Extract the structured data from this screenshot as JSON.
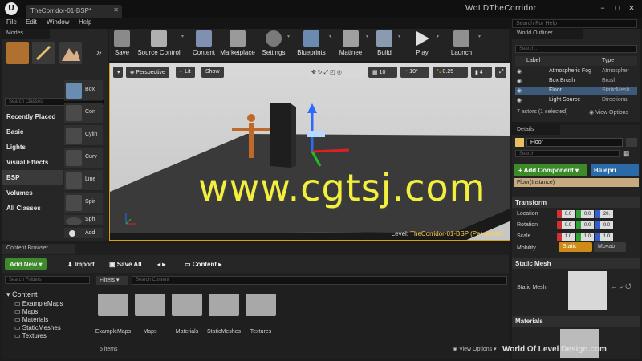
{
  "window": {
    "tab": "TheCorridor-01-BSP*",
    "project": "WoLDTheCorridor",
    "buttons": [
      "−",
      "□",
      "✕"
    ]
  },
  "menu": {
    "items": [
      "File",
      "Edit",
      "Window",
      "Help"
    ],
    "search_placeholder": "Search For Help"
  },
  "modes": {
    "tab": "Modes",
    "search_placeholder": "Search Classes",
    "categories": [
      "Recently Placed",
      "Basic",
      "Lights",
      "Visual Effects",
      "BSP",
      "Volumes",
      "All Classes"
    ],
    "selected_category": "BSP",
    "items": [
      "Box",
      "Con",
      "Cylin",
      "Curv",
      "Line",
      "Spir",
      "Sph",
      "Add"
    ]
  },
  "toolbar": {
    "buttons": [
      "Save",
      "Source Control",
      "Content",
      "Marketplace",
      "Settings",
      "Blueprints",
      "Matinee",
      "Build",
      "Play",
      "Launch"
    ]
  },
  "viewport": {
    "menu": "▾",
    "perspective": "Perspective",
    "lit": "Lit",
    "show": "Show",
    "grid_snap": "10",
    "rot_snap": "10°",
    "scale_snap": "0.25",
    "cam_speed": "4",
    "level_prefix": "Level:",
    "level_name": "TheCorridor-01-BSP (Persistent)",
    "overlay": "www.cgtsj.com"
  },
  "outliner": {
    "tab": "World Outliner",
    "search_placeholder": "Search...",
    "col_label": "Label",
    "col_type": "Type",
    "rows": [
      {
        "name": "Atmospheric Fog",
        "type": "Atmospher"
      },
      {
        "name": "Box Brush",
        "type": "Brush"
      },
      {
        "name": "Floor",
        "type": "StaticMesh"
      },
      {
        "name": "Light Source",
        "type": "Directional"
      }
    ],
    "selected": "Floor",
    "status": "7 actors (1 selected)",
    "view_options": "View Options"
  },
  "details": {
    "tab": "Details",
    "selected_name": "Floor",
    "search_placeholder": "Search",
    "add_component": "+ Add Component ▾",
    "blueprint": "Bluepri",
    "instance": "Floor(Instance)",
    "transform": "Transform",
    "location": "Location",
    "rotation": "Rotation",
    "scale": "Scale",
    "loc": [
      "0.0",
      "0.0",
      "20."
    ],
    "rot": [
      "0.0",
      "0.0",
      "0.0"
    ],
    "scl": [
      "1.0",
      "1.0",
      "1.0"
    ],
    "mobility": "Mobility",
    "static": "Static",
    "movable": "Movab",
    "static_mesh_section": "Static Mesh",
    "static_mesh_label": "Static Mesh",
    "materials": "Materials"
  },
  "content_browser": {
    "tab": "Content Browser",
    "add_new": "Add New ▾",
    "import": "Import",
    "save_all": "Save All",
    "path": "Content",
    "folder_search": "Search Folders",
    "filters": "Filters ▾",
    "search_placeholder": "Search Content",
    "tree_root": "Content",
    "tree": [
      "ExampleMaps",
      "Maps",
      "Materials",
      "StaticMeshes",
      "Textures"
    ],
    "folders": [
      "ExampleMaps",
      "Maps",
      "Materials",
      "StaticMeshes",
      "Textures"
    ],
    "count": "5 items",
    "view_options": "View Options ▾"
  },
  "watermark": "World Of Level Design.com",
  "colors": {
    "accent_green": "#3c8a2a",
    "accent_blue": "#2a6aa8",
    "selection": "#3d5a7a",
    "static_orange": "#d08a18",
    "overlay_yellow": "#f2f03c"
  }
}
